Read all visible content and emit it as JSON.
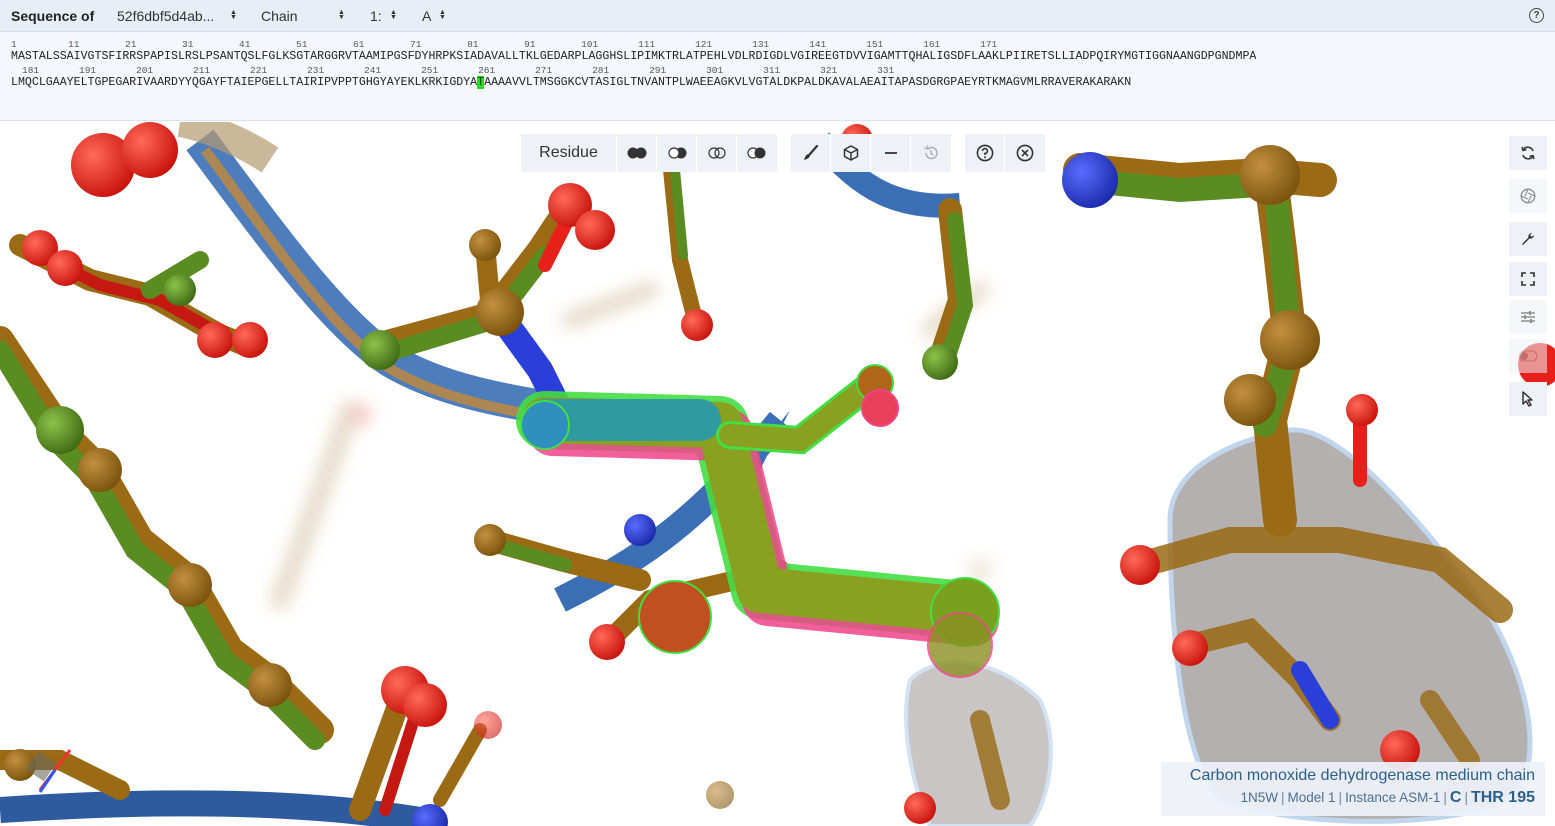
{
  "sequence_panel": {
    "title": "Sequence of",
    "entity_select": "52f6dbf5d4ab...",
    "mode_select": "Chain",
    "model_select": "1:",
    "chain_select": "A",
    "help_icon": "question-circle-icon",
    "row1_numbers": "1         11        21        31        41        51        61        71        81        91        101       111       121       131       141       151       161       171",
    "row1_sequence": "MASTALSSAIVGTSFIRRSPAPISLRSLPSANTQSLFGLKSGTARGGRVTAAMIPGSFDYHRPKSIADAVALLTKLGEDARPLAGGHSLIPIMKTRLATPEHLVDLRDIGDLVGIREEGTDVVIGAMTTQHALIGSDFLAAKLPIIRETSLLIADPQIRYMGTIGGNAANGDPGNDMPA",
    "row2_numbers": "181       191       201       211       221       231       241       251       261       271       281       291       301       311       321       331",
    "row2_before": "LMQCLGAAYELTGPEGARIVAARDYYQGAYFTAIEPGELLTAIRIPVPPTGHGYAYEKLKRKIGDYA",
    "row2_selected": "T",
    "row2_after": "AAAAVVLTMSGGKCVTASIGLTNVANTPLWAEEAGKVLVGTALDKPALDKAVALAEAITAPASDGRGPAEYRTKMAGVMLRRAVERAKARAKN"
  },
  "toolbar": {
    "focus_label": "Residue",
    "buttons": [
      {
        "name": "overlay-both-icon"
      },
      {
        "name": "overlay-left-icon"
      },
      {
        "name": "overlay-outline-icon"
      },
      {
        "name": "overlay-right-icon"
      },
      {
        "name": "paintbrush-icon"
      },
      {
        "name": "cube-icon"
      },
      {
        "name": "minus-icon"
      },
      {
        "name": "history-icon"
      },
      {
        "name": "help-icon"
      },
      {
        "name": "close-icon"
      }
    ]
  },
  "side_controls": [
    "refresh-icon",
    "camera-shutter-icon",
    "wrench-icon",
    "expand-icon",
    "sliders-icon",
    "toggle-icon",
    "cursor-pointer-icon"
  ],
  "info": {
    "title": "Carbon monoxide dehydrogenase medium chain",
    "pdb_id": "1N5W",
    "model": "Model 1",
    "instance": "Instance ASM-1",
    "chain": "C",
    "residue": "THR 195"
  },
  "colors": {
    "header_bg": "#e8eef6",
    "seq_highlight": "#22dd22",
    "atom_oxygen": "#e8201a",
    "atom_nitrogen": "#2a3fd8",
    "carbon_green": "#5a8c22",
    "carbon_brown": "#9a6a14",
    "cartoon_blue": "#3a6fb5",
    "selection_outline": "#44dd44",
    "info_text": "#2c5f8a"
  }
}
